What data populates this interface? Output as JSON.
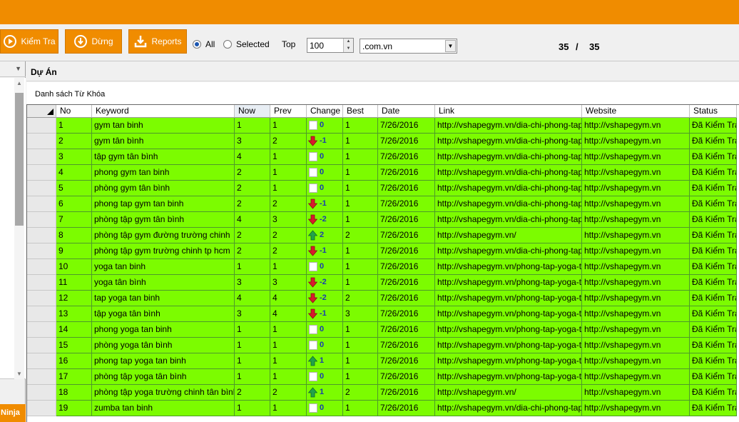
{
  "toolbar": {
    "buttons": [
      {
        "label": "Kiểm Tra",
        "icon": "play-circle-icon"
      },
      {
        "label": "Dừng",
        "icon": "stop-circle-icon"
      },
      {
        "label": "Reports",
        "icon": "download-icon"
      }
    ],
    "radio_all": "All",
    "radio_selected": "Selected",
    "selected_option": "All",
    "top_label": "Top",
    "top_value": "100",
    "domain_value": ".com.vn",
    "counter_current": "35",
    "counter_sep": "/",
    "counter_total": "35"
  },
  "left_panel": {
    "footer_label": "Ninja"
  },
  "section": {
    "project_label": "Dự Án",
    "keyword_list_label": "Danh sách Từ Khóa"
  },
  "table": {
    "columns": [
      "No",
      "Keyword",
      "Now",
      "Prev",
      "Change",
      "Best",
      "Date",
      "Link",
      "Website",
      "Status"
    ],
    "rows": [
      {
        "no": "1",
        "keyword": "gym tan binh",
        "now": "1",
        "prev": "1",
        "change": "0",
        "dir": "none",
        "best": "1",
        "date": "7/26/2016",
        "link": "http://vshapegym.vn/dia-chi-phong-tap-...",
        "website": "http://vshapegym.vn",
        "status": "Đã Kiểm Tra"
      },
      {
        "no": "2",
        "keyword": "gym tân bình",
        "now": "3",
        "prev": "2",
        "change": "-1",
        "dir": "down",
        "best": "1",
        "date": "7/26/2016",
        "link": "http://vshapegym.vn/dia-chi-phong-tap-...",
        "website": "http://vshapegym.vn",
        "status": "Đã Kiểm Tra"
      },
      {
        "no": "3",
        "keyword": "tập gym tân bình",
        "now": "4",
        "prev": "1",
        "change": "0",
        "dir": "none",
        "best": "1",
        "date": "7/26/2016",
        "link": "http://vshapegym.vn/dia-chi-phong-tap-...",
        "website": "http://vshapegym.vn",
        "status": "Đã Kiểm Tra"
      },
      {
        "no": "4",
        "keyword": "phong gym tan binh",
        "now": "2",
        "prev": "1",
        "change": "0",
        "dir": "none",
        "best": "1",
        "date": "7/26/2016",
        "link": "http://vshapegym.vn/dia-chi-phong-tap-...",
        "website": "http://vshapegym.vn",
        "status": "Đã Kiểm Tra"
      },
      {
        "no": "5",
        "keyword": "phòng gym tân bình",
        "now": "2",
        "prev": "1",
        "change": "0",
        "dir": "none",
        "best": "1",
        "date": "7/26/2016",
        "link": "http://vshapegym.vn/dia-chi-phong-tap-...",
        "website": "http://vshapegym.vn",
        "status": "Đã Kiểm Tra"
      },
      {
        "no": "6",
        "keyword": "phong tap gym tan binh",
        "now": "2",
        "prev": "2",
        "change": "-1",
        "dir": "down",
        "best": "1",
        "date": "7/26/2016",
        "link": "http://vshapegym.vn/dia-chi-phong-tap-...",
        "website": "http://vshapegym.vn",
        "status": "Đã Kiểm Tra"
      },
      {
        "no": "7",
        "keyword": "phòng tập gym tân bình",
        "now": "4",
        "prev": "3",
        "change": "-2",
        "dir": "down",
        "best": "1",
        "date": "7/26/2016",
        "link": "http://vshapegym.vn/dia-chi-phong-tap-...",
        "website": "http://vshapegym.vn",
        "status": "Đã Kiểm Tra"
      },
      {
        "no": "8",
        "keyword": "phòng tập gym đường trường chinh",
        "now": "2",
        "prev": "2",
        "change": "2",
        "dir": "up",
        "best": "2",
        "date": "7/26/2016",
        "link": "http://vshapegym.vn/",
        "website": "http://vshapegym.vn",
        "status": "Đã Kiểm Tra"
      },
      {
        "no": "9",
        "keyword": "phòng tập gym trường chinh tp hcm",
        "now": "2",
        "prev": "2",
        "change": "-1",
        "dir": "down",
        "best": "1",
        "date": "7/26/2016",
        "link": "http://vshapegym.vn/dia-chi-phong-tap-...",
        "website": "http://vshapegym.vn",
        "status": "Đã Kiểm Tra"
      },
      {
        "no": "10",
        "keyword": "yoga tan binh",
        "now": "1",
        "prev": "1",
        "change": "0",
        "dir": "none",
        "best": "1",
        "date": "7/26/2016",
        "link": "http://vshapegym.vn/phong-tap-yoga-ta-...",
        "website": "http://vshapegym.vn",
        "status": "Đã Kiểm Tra"
      },
      {
        "no": "11",
        "keyword": "yoga tân bình",
        "now": "3",
        "prev": "3",
        "change": "-2",
        "dir": "down",
        "best": "1",
        "date": "7/26/2016",
        "link": "http://vshapegym.vn/phong-tap-yoga-ta-...",
        "website": "http://vshapegym.vn",
        "status": "Đã Kiểm Tra"
      },
      {
        "no": "12",
        "keyword": "tap yoga tan binh",
        "now": "4",
        "prev": "4",
        "change": "-2",
        "dir": "down",
        "best": "2",
        "date": "7/26/2016",
        "link": "http://vshapegym.vn/phong-tap-yoga-ta-...",
        "website": "http://vshapegym.vn",
        "status": "Đã Kiểm Tra"
      },
      {
        "no": "13",
        "keyword": "tập yoga tân bình",
        "now": "3",
        "prev": "4",
        "change": "-1",
        "dir": "down",
        "best": "3",
        "date": "7/26/2016",
        "link": "http://vshapegym.vn/phong-tap-yoga-ta-...",
        "website": "http://vshapegym.vn",
        "status": "Đã Kiểm Tra"
      },
      {
        "no": "14",
        "keyword": "phong yoga tan binh",
        "now": "1",
        "prev": "1",
        "change": "0",
        "dir": "none",
        "best": "1",
        "date": "7/26/2016",
        "link": "http://vshapegym.vn/phong-tap-yoga-ta-...",
        "website": "http://vshapegym.vn",
        "status": "Đã Kiểm Tra"
      },
      {
        "no": "15",
        "keyword": "phòng yoga tân bình",
        "now": "1",
        "prev": "1",
        "change": "0",
        "dir": "none",
        "best": "1",
        "date": "7/26/2016",
        "link": "http://vshapegym.vn/phong-tap-yoga-ta-...",
        "website": "http://vshapegym.vn",
        "status": "Đã Kiểm Tra"
      },
      {
        "no": "16",
        "keyword": "phong tap yoga tan binh",
        "now": "1",
        "prev": "1",
        "change": "1",
        "dir": "up",
        "best": "1",
        "date": "7/26/2016",
        "link": "http://vshapegym.vn/phong-tap-yoga-ta-...",
        "website": "http://vshapegym.vn",
        "status": "Đã Kiểm Tra"
      },
      {
        "no": "17",
        "keyword": "phòng tập yoga tân bình",
        "now": "1",
        "prev": "1",
        "change": "0",
        "dir": "none",
        "best": "1",
        "date": "7/26/2016",
        "link": "http://vshapegym.vn/phong-tap-yoga-ta-...",
        "website": "http://vshapegym.vn",
        "status": "Đã Kiểm Tra"
      },
      {
        "no": "18",
        "keyword": "phòng tập yoga trường chinh tân bình",
        "now": "2",
        "prev": "2",
        "change": "1",
        "dir": "up",
        "best": "2",
        "date": "7/26/2016",
        "link": "http://vshapegym.vn/",
        "website": "http://vshapegym.vn",
        "status": "Đã Kiểm Tra"
      },
      {
        "no": "19",
        "keyword": "zumba tan binh",
        "now": "1",
        "prev": "1",
        "change": "0",
        "dir": "none",
        "best": "1",
        "date": "7/26/2016",
        "link": "http://vshapegym.vn/dia-chi-phong-tap-...",
        "website": "http://vshapegym.vn",
        "status": "Đã Kiểm Tra"
      }
    ]
  },
  "colors": {
    "accent": "#f08c00",
    "row_fill": "#7cfc00",
    "change_number": "#1a3cb0",
    "arrow_down": "#d81b2c",
    "arrow_up": "#22a34a"
  }
}
